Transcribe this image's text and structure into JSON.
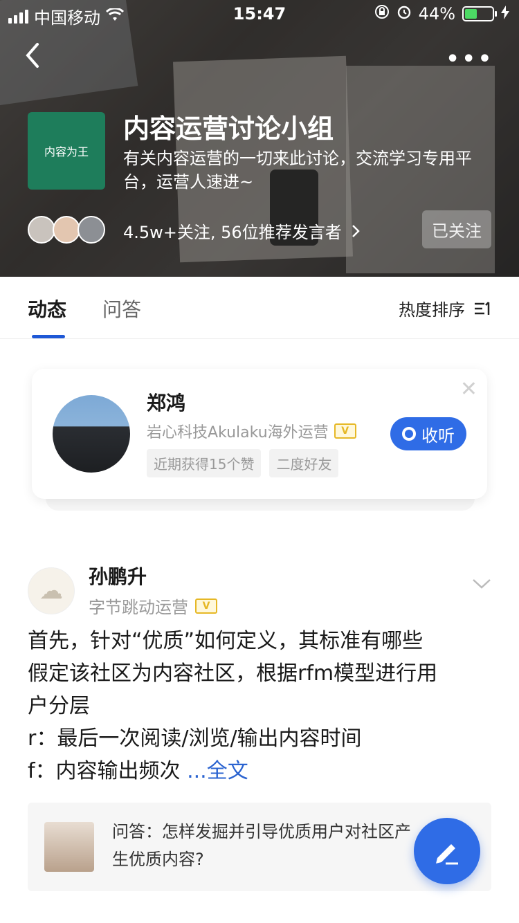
{
  "status_bar": {
    "carrier": "中国移动",
    "time": "15:47",
    "battery": "44%",
    "battery_level": 0.44
  },
  "group": {
    "logo_text": "内容为王",
    "title": "内容运营讨论小组",
    "description": "有关内容运营的一切来此讨论，交流学习专用平台，运营人速进~",
    "followers": "4.5w+关注, 56位推荐发言者",
    "follow_state": "已关注"
  },
  "tabs": {
    "items": [
      "动态",
      "问答"
    ],
    "sort_label": "热度排序"
  },
  "recommend_card": {
    "name": "郑鸿",
    "company": "岩心科技Akulaku海外运营",
    "verified_badge": "V",
    "tags": [
      "近期获得15个赞",
      "二度好友"
    ],
    "listen_label": "收听"
  },
  "post": {
    "author": "孙鹏升",
    "company": "字节跳动运营",
    "verified_badge": "V",
    "body_lines": [
      "首先，针对“优质”如何定义，其标准有哪些",
      "假定该社区为内容社区，根据rfm模型进行用",
      "户分层",
      "r：最后一次阅读/浏览/输出内容时间",
      "f：内容输出频次 "
    ],
    "read_more": "...全文",
    "qa_text": "问答：怎样发掘并引导优质用户对社区产生优质内容?"
  },
  "colors": {
    "accent": "#2f6ce6",
    "logo_bg": "#1e7d5b",
    "verified": "#e6b826"
  }
}
